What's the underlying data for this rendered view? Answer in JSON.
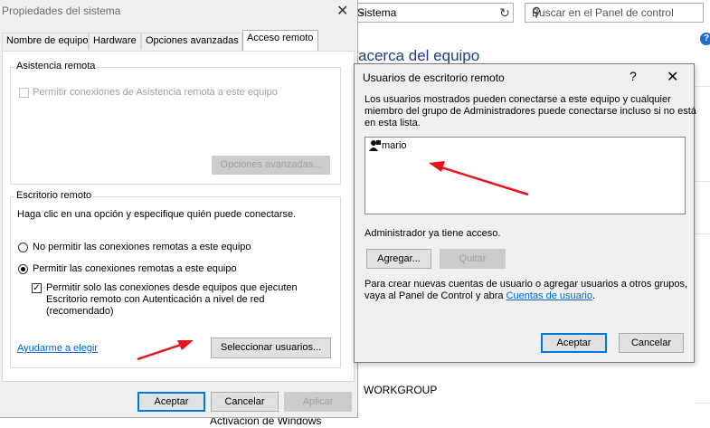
{
  "background": {
    "address_text": "Sistema",
    "search_placeholder": "Buscar en el Panel de control",
    "heading": "acerca del equipo",
    "workgroup": "WORKGROUP",
    "activation": "Activación de Windows",
    "help_glyph": "?"
  },
  "system_properties": {
    "title": "Propiedades del sistema",
    "close_glyph": "✕",
    "tabs": [
      {
        "label": "Nombre de equipo"
      },
      {
        "label": "Hardware"
      },
      {
        "label": "Opciones avanzadas"
      },
      {
        "label": "Acceso remoto"
      }
    ],
    "active_tab": "Acceso remoto",
    "remote_assistance": {
      "group_label": "Asistencia remota",
      "allow_label": "Permitir conexiones de Asistencia remota a este equipo",
      "allow_checked": false,
      "advanced_button": "Opciones avanzadas..."
    },
    "remote_desktop": {
      "group_label": "Escritorio remoto",
      "instructions": "Haga clic en una opción y especifique quién puede conectarse.",
      "option_disallow": "No permitir las conexiones remotas a este equipo",
      "option_allow": "Permitir las conexiones remotas a este equipo",
      "selected_option": "allow",
      "nla_line1": "Permitir solo las conexiones desde equipos que ejecuten",
      "nla_line2": "Escritorio remoto con Autenticación a nivel de red",
      "nla_line3": "(recomendado)",
      "nla_checked": true,
      "help_link": "Ayudarme a elegir",
      "select_users_button": "Seleccionar usuarios..."
    },
    "footer": {
      "ok": "Aceptar",
      "cancel": "Cancelar",
      "apply": "Aplicar"
    }
  },
  "remote_users_dialog": {
    "title": "Usuarios de escritorio remoto",
    "help_glyph": "?",
    "close_glyph": "✕",
    "description_line1": "Los usuarios mostrados pueden conectarse a este equipo y cualquier",
    "description_line2": "miembro del grupo de Administradores puede conectarse incluso si no está",
    "description_line3": "en esta lista.",
    "users": [
      {
        "name": "mario"
      }
    ],
    "admin_note": "Administrador ya tiene acceso.",
    "add_button": "Agregar...",
    "remove_button": "Quitar",
    "create_line1": "Para crear nuevas cuentas de usuario o agregar usuarios a otros grupos,",
    "create_line2_prefix": "vaya al Panel de Control y abra",
    "create_link": "Cuentas de usuario",
    "create_line2_suffix": ".",
    "ok_button": "Aceptar",
    "cancel_button": "Cancelar"
  },
  "annotation_color": "#e8141b"
}
